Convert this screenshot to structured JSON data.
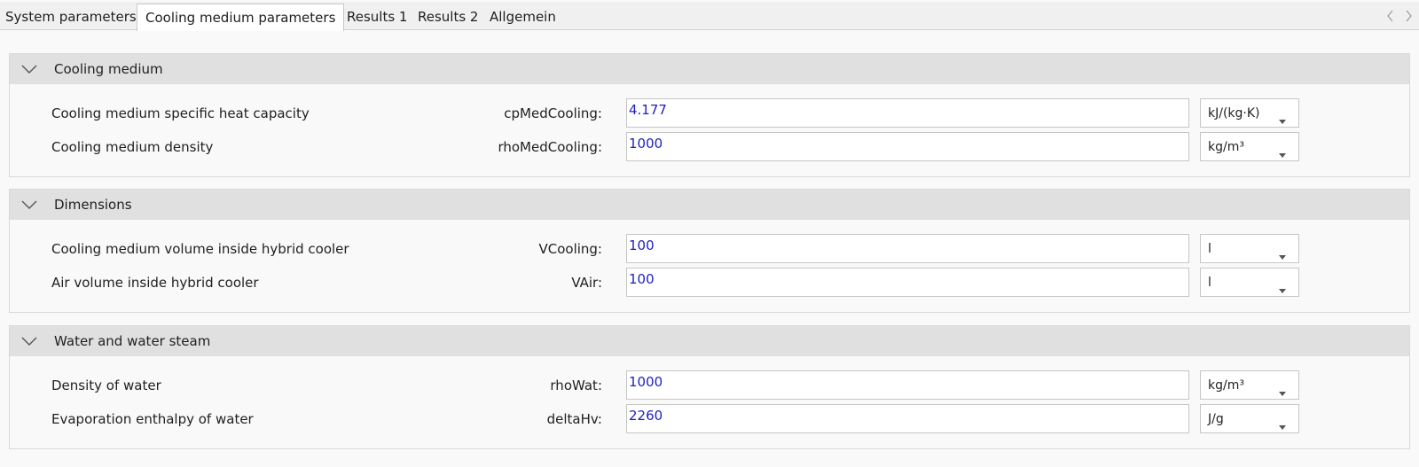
{
  "tabs": [
    {
      "label": "System parameters"
    },
    {
      "label": "Cooling medium parameters"
    },
    {
      "label": "Results 1"
    },
    {
      "label": "Results 2"
    },
    {
      "label": "Allgemein"
    }
  ],
  "active_tab": "Cooling medium parameters",
  "groups": [
    {
      "title": "Cooling medium",
      "rows": [
        {
          "label": "Cooling medium specific heat capacity",
          "var": "cpMedCooling:",
          "value": "4.177",
          "unit": "kJ/(kg·K)"
        },
        {
          "label": "Cooling medium density",
          "var": "rhoMedCooling:",
          "value": "1000",
          "unit": "kg/m³"
        }
      ]
    },
    {
      "title": "Dimensions",
      "rows": [
        {
          "label": "Cooling medium volume inside hybrid cooler",
          "var": "VCooling:",
          "value": "100",
          "unit": "l"
        },
        {
          "label": "Air volume inside hybrid cooler",
          "var": "VAir:",
          "value": "100",
          "unit": "l"
        }
      ]
    },
    {
      "title": "Water and water steam",
      "rows": [
        {
          "label": "Density of water",
          "var": "rhoWat:",
          "value": "1000",
          "unit": "kg/m³"
        },
        {
          "label": "Evaporation enthalpy of water",
          "var": "deltaHv:",
          "value": "2260",
          "unit": "J/g"
        }
      ]
    }
  ],
  "icons": {
    "tab_scroll_left": "chevron-left-icon",
    "tab_scroll_right": "chevron-right-icon",
    "group_collapse": "chevron-down-icon",
    "unit_dropdown": "dropdown-arrow-icon"
  },
  "colors": {
    "value_text": "#2020c0",
    "group_header_bg": "#e0e0e0"
  }
}
